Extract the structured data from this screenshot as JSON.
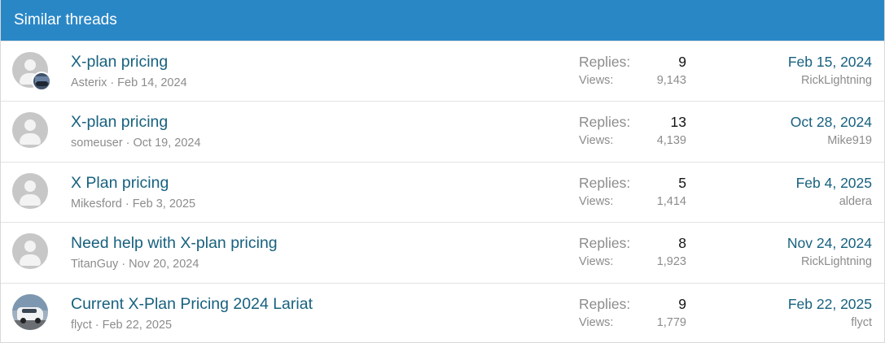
{
  "header": {
    "title": "Similar threads"
  },
  "labels": {
    "replies": "Replies:",
    "views": "Views:"
  },
  "threads": [
    {
      "title": "X-plan pricing",
      "author": "Asterix",
      "date": "Feb 14, 2024",
      "replies": "9",
      "views": "9,143",
      "last_date": "Feb 15, 2024",
      "last_user": "RickLightning",
      "avatar": "default-avatar-icon"
    },
    {
      "title": "X-plan pricing",
      "author": "someuser",
      "date": "Oct 19, 2024",
      "replies": "13",
      "views": "4,139",
      "last_date": "Oct 28, 2024",
      "last_user": "Mike919",
      "avatar": "default-avatar-icon"
    },
    {
      "title": "X Plan pricing",
      "author": "Mikesford",
      "date": "Feb 3, 2025",
      "replies": "5",
      "views": "1,414",
      "last_date": "Feb 4, 2025",
      "last_user": "aldera",
      "avatar": "default-avatar-icon"
    },
    {
      "title": "Need help with X-plan pricing",
      "author": "TitanGuy",
      "date": "Nov 20, 2024",
      "replies": "8",
      "views": "1,923",
      "last_date": "Nov 24, 2024",
      "last_user": "RickLightning",
      "avatar": "default-avatar-icon"
    },
    {
      "title": "Current X-Plan Pricing 2024 Lariat",
      "author": "flyct",
      "date": "Feb 22, 2025",
      "replies": "9",
      "views": "1,779",
      "last_date": "Feb 22, 2025",
      "last_user": "flyct",
      "avatar": "photo-avatar"
    }
  ],
  "colors": {
    "header_bg": "#2a87c6",
    "link": "#17617f",
    "muted": "#8c8c8c"
  }
}
